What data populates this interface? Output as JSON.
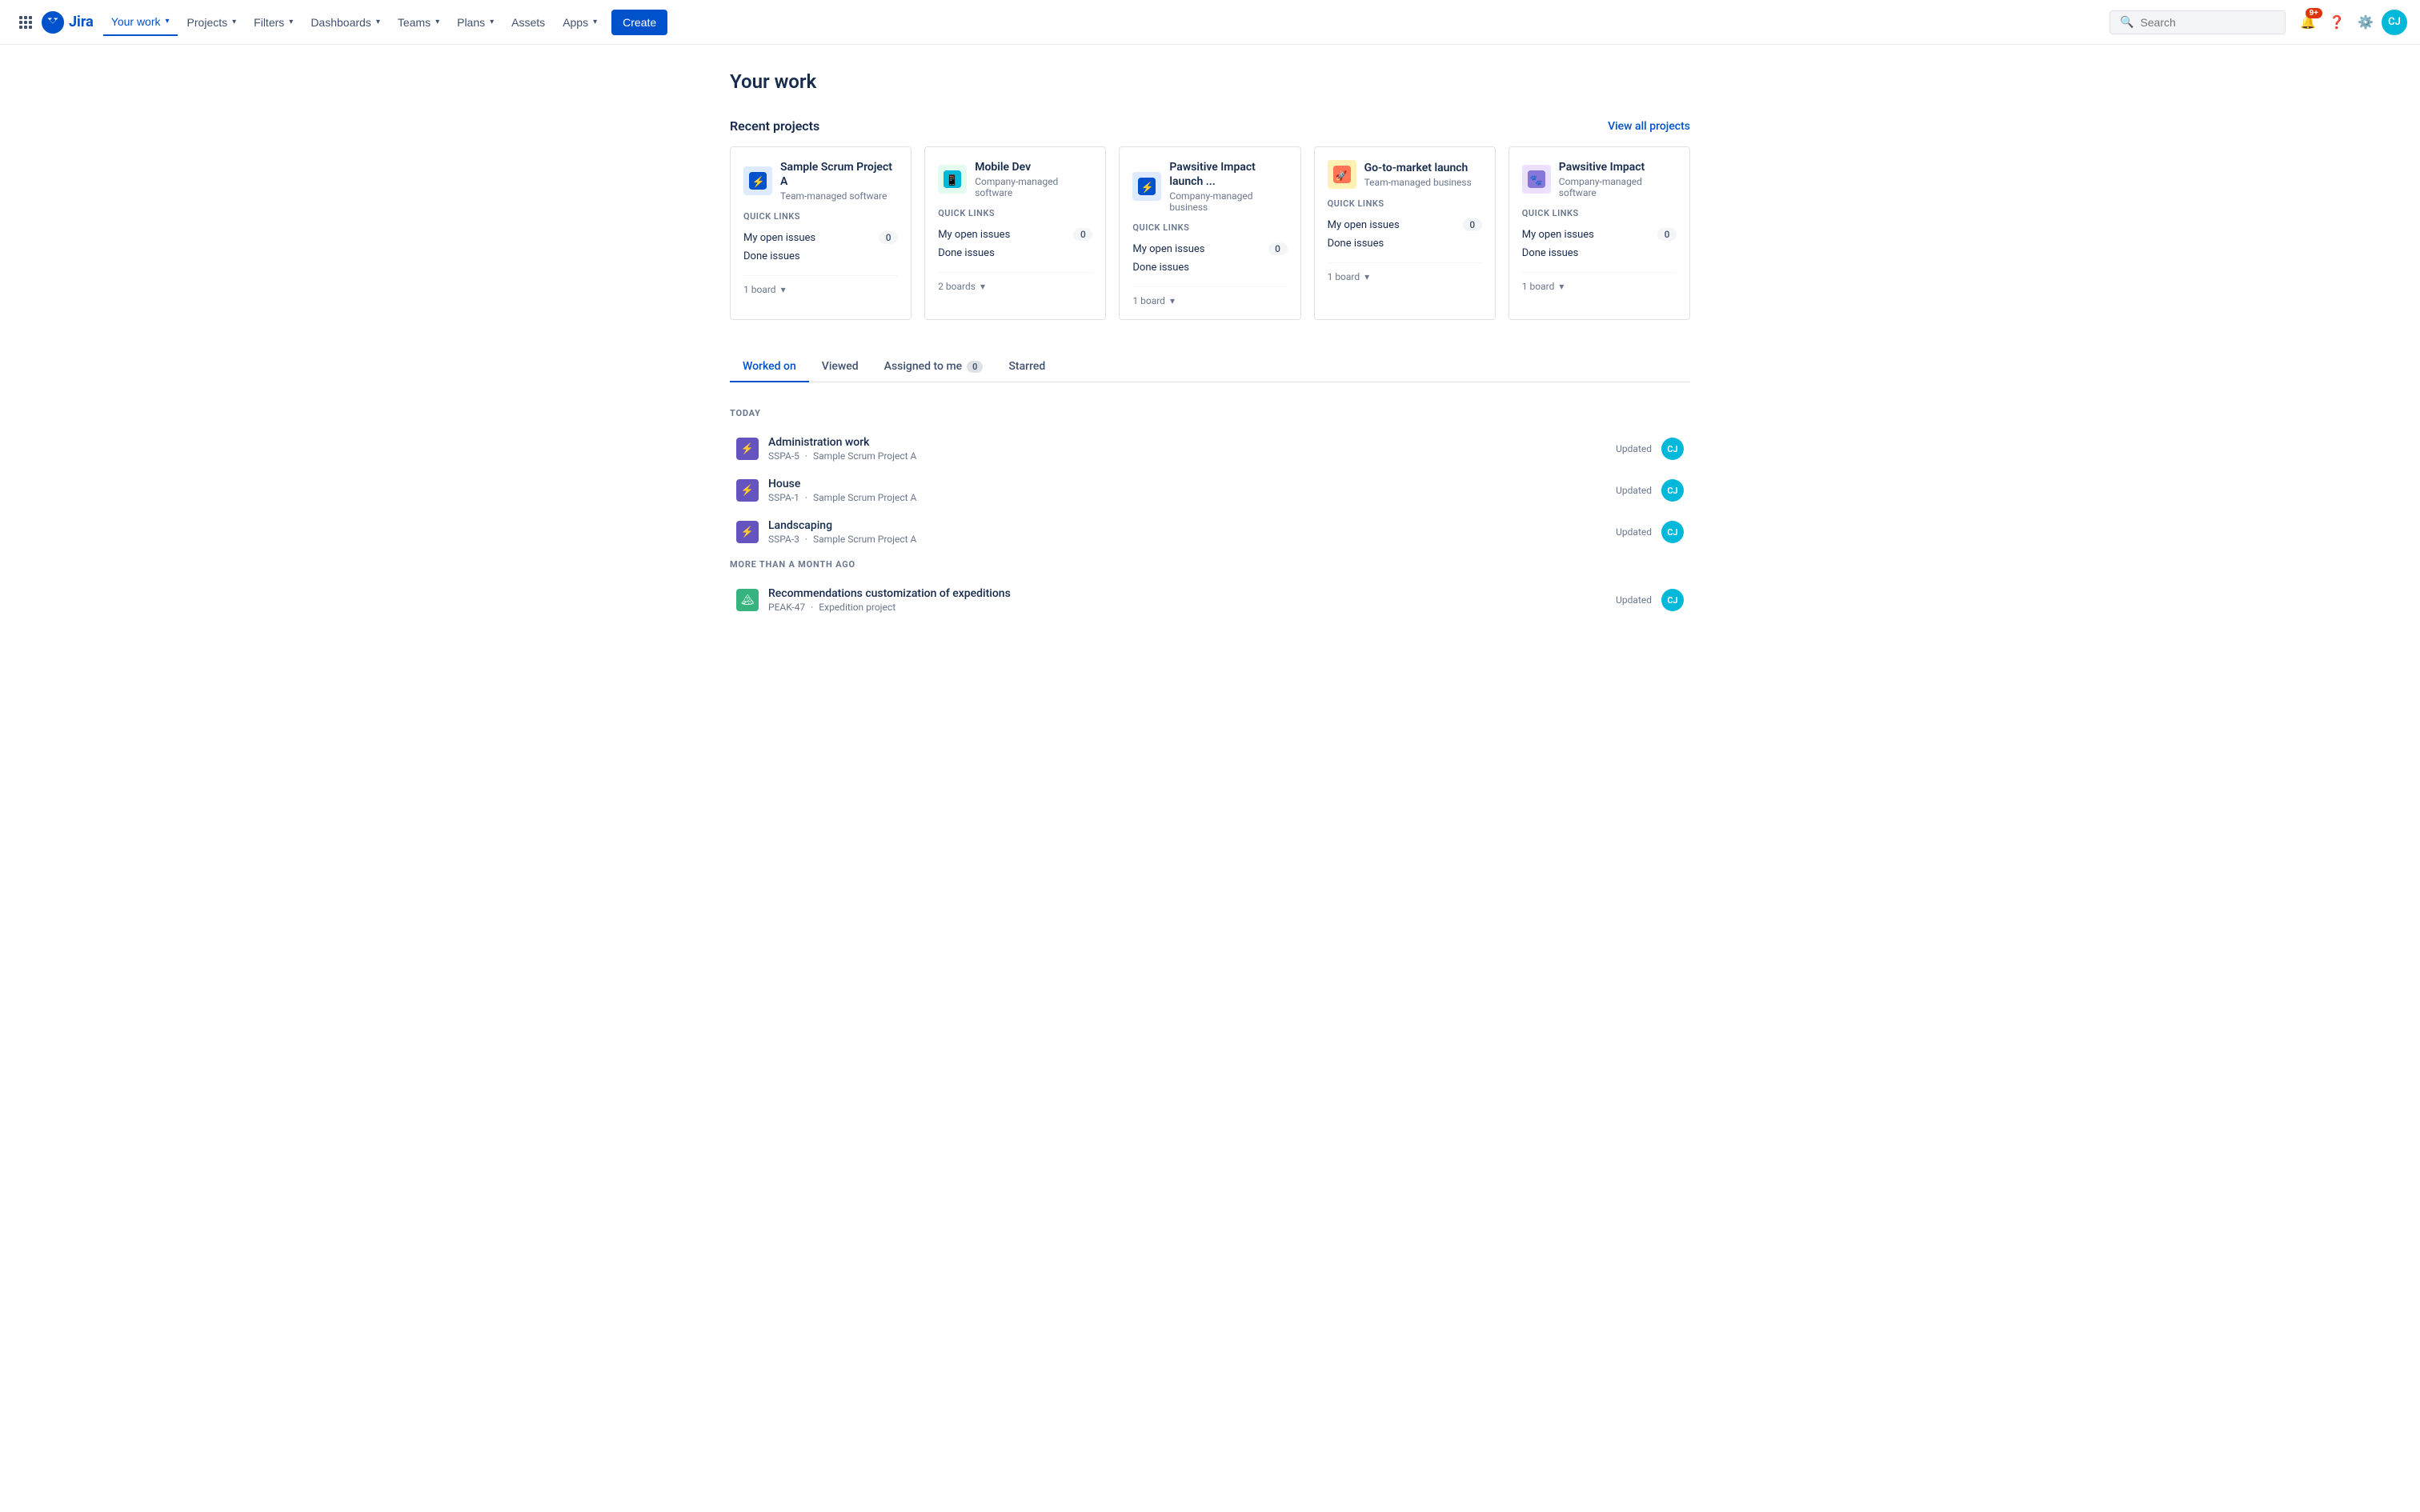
{
  "nav": {
    "logo_text": "Jira",
    "items": [
      {
        "id": "your-work",
        "label": "Your work",
        "has_chevron": true,
        "active": true
      },
      {
        "id": "projects",
        "label": "Projects",
        "has_chevron": true
      },
      {
        "id": "filters",
        "label": "Filters",
        "has_chevron": true
      },
      {
        "id": "dashboards",
        "label": "Dashboards",
        "has_chevron": true
      },
      {
        "id": "teams",
        "label": "Teams",
        "has_chevron": true
      },
      {
        "id": "plans",
        "label": "Plans",
        "has_chevron": true
      },
      {
        "id": "assets",
        "label": "Assets",
        "has_chevron": false
      },
      {
        "id": "apps",
        "label": "Apps",
        "has_chevron": true
      }
    ],
    "create_label": "Create",
    "search_placeholder": "Search",
    "notification_badge": "9+",
    "avatar_initials": "CJ"
  },
  "page": {
    "title": "Your work"
  },
  "recent_projects": {
    "section_title": "Recent projects",
    "view_all_label": "View all projects",
    "projects": [
      {
        "id": "sspa",
        "name": "Sample Scrum Project A",
        "type": "Team-managed software",
        "icon_type": "blue",
        "icon_symbol": "⚡",
        "quick_links_label": "QUICK LINKS",
        "my_open_issues_label": "My open issues",
        "my_open_issues_count": "0",
        "done_issues_label": "Done issues",
        "boards_label": "1 board"
      },
      {
        "id": "mobiledev",
        "name": "Mobile Dev",
        "type": "Company-managed software",
        "icon_type": "teal",
        "icon_symbol": "📱",
        "quick_links_label": "QUICK LINKS",
        "my_open_issues_label": "My open issues",
        "my_open_issues_count": "0",
        "done_issues_label": "Done issues",
        "boards_label": "2 boards"
      },
      {
        "id": "pil",
        "name": "Pawsitive Impact launch ...",
        "type": "Company-managed business",
        "icon_type": "blue",
        "icon_symbol": "⚡",
        "quick_links_label": "QUICK LINKS",
        "my_open_issues_label": "My open issues",
        "my_open_issues_count": "0",
        "done_issues_label": "Done issues",
        "boards_label": "1 board"
      },
      {
        "id": "gtm",
        "name": "Go-to-market launch",
        "type": "Team-managed business",
        "icon_type": "orange",
        "icon_symbol": "🚀",
        "quick_links_label": "QUICK LINKS",
        "my_open_issues_label": "My open issues",
        "my_open_issues_count": "0",
        "done_issues_label": "Done issues",
        "boards_label": "1 board"
      },
      {
        "id": "pi",
        "name": "Pawsitive Impact",
        "type": "Company-managed software",
        "icon_type": "purple",
        "icon_symbol": "🐾",
        "quick_links_label": "QUICK LINKS",
        "my_open_issues_label": "My open issues",
        "my_open_issues_count": "0",
        "done_issues_label": "Done issues",
        "boards_label": "1 board"
      }
    ]
  },
  "tabs": [
    {
      "id": "worked-on",
      "label": "Worked on",
      "active": true,
      "badge": null
    },
    {
      "id": "viewed",
      "label": "Viewed",
      "active": false,
      "badge": null
    },
    {
      "id": "assigned-to-me",
      "label": "Assigned to me",
      "active": false,
      "badge": "0"
    },
    {
      "id": "starred",
      "label": "Starred",
      "active": false,
      "badge": null
    }
  ],
  "work_sections": [
    {
      "id": "today",
      "label": "TODAY",
      "items": [
        {
          "id": "sspa-5",
          "name": "Administration work",
          "key": "SSPA-5",
          "project": "Sample Scrum Project A",
          "icon_type": "purple",
          "icon_symbol": "⚡",
          "status_label": "Updated",
          "avatar_initials": "CJ"
        },
        {
          "id": "sspa-1",
          "name": "House",
          "key": "SSPA-1",
          "project": "Sample Scrum Project A",
          "icon_type": "purple",
          "icon_symbol": "⚡",
          "status_label": "Updated",
          "avatar_initials": "CJ"
        },
        {
          "id": "sspa-3",
          "name": "Landscaping",
          "key": "SSPA-3",
          "project": "Sample Scrum Project A",
          "icon_type": "purple",
          "icon_symbol": "⚡",
          "status_label": "Updated",
          "avatar_initials": "CJ"
        }
      ]
    },
    {
      "id": "more-than-month",
      "label": "MORE THAN A MONTH AGO",
      "items": [
        {
          "id": "peak-47",
          "name": "Recommendations customization of expeditions",
          "key": "PEAK-47",
          "project": "Expedition project",
          "icon_type": "green",
          "icon_symbol": "🏔",
          "status_label": "Updated",
          "avatar_initials": "CJ"
        }
      ]
    }
  ]
}
